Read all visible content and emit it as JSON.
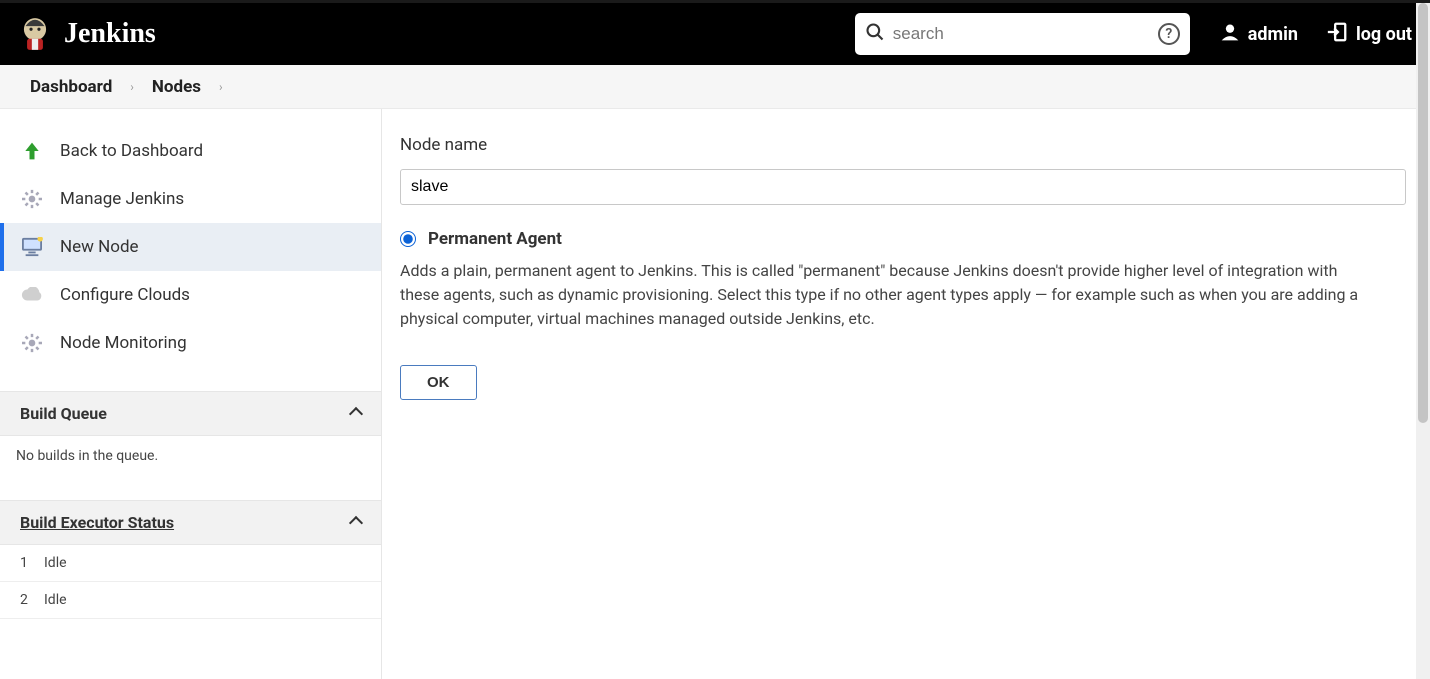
{
  "header": {
    "brand": "Jenkins",
    "search_placeholder": "search",
    "user_label": "admin",
    "logout_label": "log out"
  },
  "breadcrumb": {
    "items": [
      "Dashboard",
      "Nodes"
    ]
  },
  "sidebar": {
    "items": [
      {
        "label": "Back to Dashboard",
        "icon": "arrow-up-green-icon",
        "active": false
      },
      {
        "label": "Manage Jenkins",
        "icon": "gear-icon",
        "active": false
      },
      {
        "label": "New Node",
        "icon": "monitor-icon",
        "active": true
      },
      {
        "label": "Configure Clouds",
        "icon": "cloud-icon",
        "active": false
      },
      {
        "label": "Node Monitoring",
        "icon": "gear-icon",
        "active": false
      }
    ],
    "build_queue": {
      "title": "Build Queue",
      "empty_text": "No builds in the queue."
    },
    "executor_status": {
      "title": "Build Executor Status",
      "rows": [
        {
          "num": "1",
          "state": "Idle"
        },
        {
          "num": "2",
          "state": "Idle"
        }
      ]
    }
  },
  "main": {
    "node_name_label": "Node name",
    "node_name_value": "slave",
    "agent_type": {
      "label": "Permanent Agent",
      "selected": true,
      "description": "Adds a plain, permanent agent to Jenkins. This is called \"permanent\" because Jenkins doesn't provide higher level of integration with these agents, such as dynamic provisioning. Select this type if no other agent types apply — for example such as when you are adding a physical computer, virtual machines managed outside Jenkins, etc."
    },
    "ok_label": "OK"
  }
}
